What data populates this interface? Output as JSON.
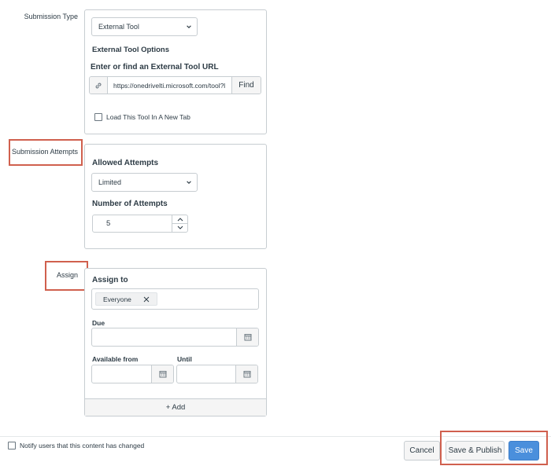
{
  "submission_type": {
    "label": "Submission Type",
    "selected": "External Tool",
    "options_heading": "External Tool Options",
    "url_heading": "Enter or find an External Tool URL",
    "url_value": "https://onedrivelti.microsoft.com/tool?l",
    "find_label": "Find",
    "new_tab_label": "Load This Tool In A New Tab"
  },
  "submission_attempts": {
    "label": "Submission Attempts",
    "allowed_heading": "Allowed Attempts",
    "allowed_selected": "Limited",
    "number_heading": "Number of Attempts",
    "number_value": "5"
  },
  "assign": {
    "label": "Assign",
    "assign_to_heading": "Assign to",
    "assignee_tag": "Everyone",
    "due_label": "Due",
    "available_from_label": "Available from",
    "until_label": "Until",
    "add_label": "+ Add"
  },
  "footer": {
    "notify_label": "Notify users that this content has changed",
    "cancel_label": "Cancel",
    "save_publish_label": "Save & Publish",
    "save_label": "Save"
  },
  "colors": {
    "highlight": "#d0604e",
    "primary": "#4a8fdc",
    "border": "#c7cdd1"
  },
  "icons": {
    "dropdown": "chevron-down-icon",
    "link": "link-icon",
    "calendar": "calendar-icon",
    "remove": "close-icon",
    "up": "chevron-up-icon",
    "down": "chevron-down-icon"
  }
}
